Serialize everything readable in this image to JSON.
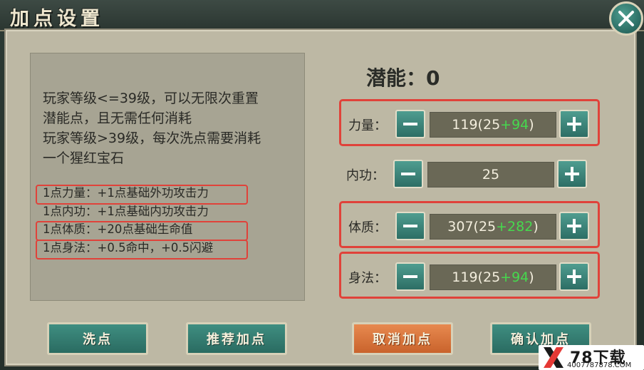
{
  "window": {
    "title": "加点设置"
  },
  "info": {
    "desc_lines": [
      "玩家等级<=39级，可以无限次重置",
      "潜能点，且无需任何消耗",
      "玩家等级>39级，每次洗点需要消耗",
      "一个猩红宝石"
    ],
    "rules": [
      "1点力量：+1点基础外功攻击力",
      "1点内功：+1点基础内功攻击力",
      "1点体质：+20点基础生命值",
      "1点身法：+0.5命中，+0.5闪避"
    ]
  },
  "potential": {
    "label": "潜能：0"
  },
  "stats": [
    {
      "label": "力量：",
      "prefix": "119(25",
      "bonus": "+94",
      "suffix": ")"
    },
    {
      "label": "内功：",
      "prefix": "25",
      "bonus": "",
      "suffix": ""
    },
    {
      "label": "体质：",
      "prefix": "307(25",
      "bonus": "+282",
      "suffix": ")"
    },
    {
      "label": "身法：",
      "prefix": "119(25",
      "bonus": "+94",
      "suffix": ")"
    }
  ],
  "buttons": {
    "reset": "洗点",
    "recommend": "推荐加点",
    "cancel": "取消加点",
    "confirm": "确认加点"
  },
  "watermark": {
    "brand": "78下载",
    "url": "4007787878.COM"
  },
  "colors": {
    "highlight_border": "#e0423a",
    "bonus_text": "#46d94e",
    "teal_button": "#3f8e81",
    "orange_button": "#e7894f"
  }
}
